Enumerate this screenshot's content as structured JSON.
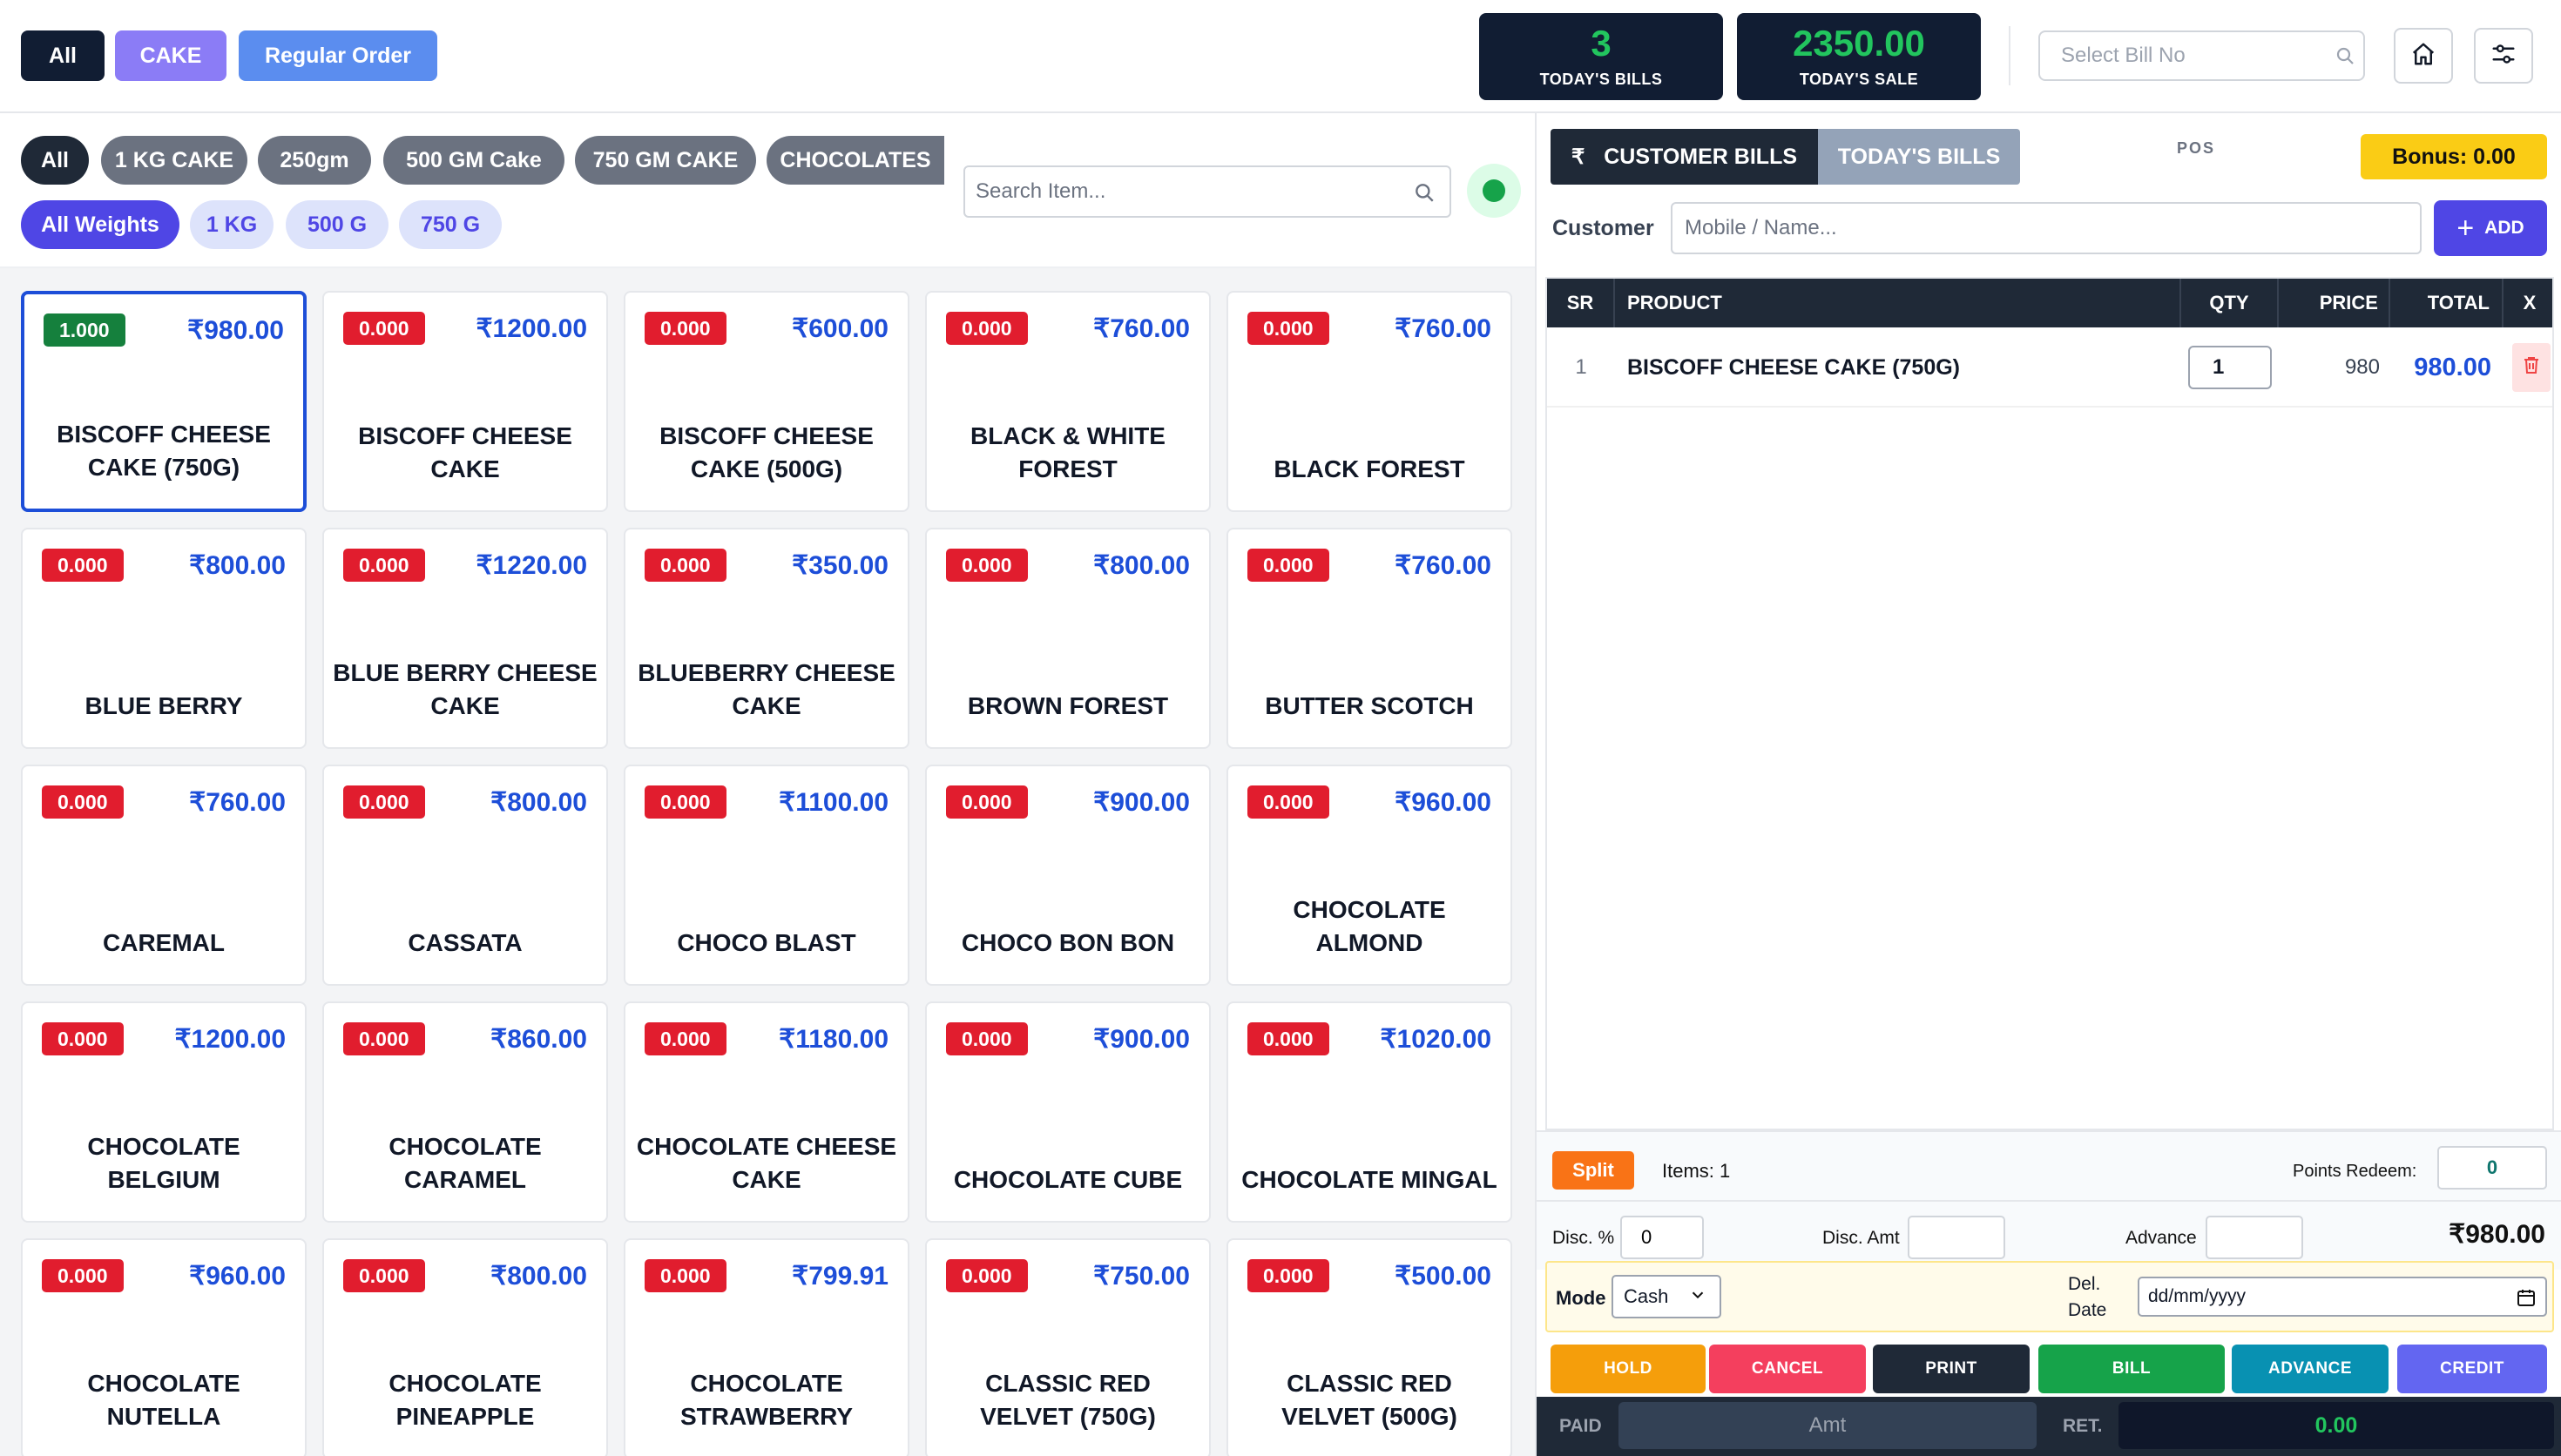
{
  "header": {
    "order_tabs": [
      "All",
      "CAKE",
      "Regular Order"
    ],
    "stats": [
      {
        "value": "3",
        "label": "TODAY'S BILLS"
      },
      {
        "value": "2350.00",
        "label": "TODAY'S SALE"
      }
    ],
    "bill_search": {
      "placeholder": "Select Bill No"
    },
    "icons": [
      "search-icon",
      "home-icon",
      "sliders-icon"
    ]
  },
  "filters": {
    "categories": [
      "All",
      "1 KG CAKE",
      "250gm",
      "500 GM Cake",
      "750 GM CAKE",
      "CHOCOLATES"
    ],
    "weights": [
      "All Weights",
      "1 KG",
      "500 G",
      "750 G"
    ],
    "search_placeholder": "Search Item...",
    "colors": {
      "online": "#16a34a",
      "accent": "#4f46e5"
    }
  },
  "products": [
    {
      "name": "BISCOFF CHEESE CAKE (750G)",
      "qty": "1.000",
      "price": "₹980.00",
      "selected": true
    },
    {
      "name": "BISCOFF CHEESE CAKE",
      "qty": "0.000",
      "price": "₹1200.00"
    },
    {
      "name": "BISCOFF CHEESE CAKE (500G)",
      "qty": "0.000",
      "price": "₹600.00"
    },
    {
      "name": "BLACK & WHITE FOREST",
      "qty": "0.000",
      "price": "₹760.00"
    },
    {
      "name": "BLACK FOREST",
      "qty": "0.000",
      "price": "₹760.00"
    },
    {
      "name": "BLUE BERRY",
      "qty": "0.000",
      "price": "₹800.00"
    },
    {
      "name": "BLUE BERRY CHEESE CAKE",
      "qty": "0.000",
      "price": "₹1220.00"
    },
    {
      "name": "BLUEBERRY CHEESE CAKE",
      "qty": "0.000",
      "price": "₹350.00"
    },
    {
      "name": "BROWN FOREST",
      "qty": "0.000",
      "price": "₹800.00"
    },
    {
      "name": "BUTTER SCOTCH",
      "qty": "0.000",
      "price": "₹760.00"
    },
    {
      "name": "CAREMAL",
      "qty": "0.000",
      "price": "₹760.00"
    },
    {
      "name": "CASSATA",
      "qty": "0.000",
      "price": "₹800.00"
    },
    {
      "name": "CHOCO BLAST",
      "qty": "0.000",
      "price": "₹1100.00"
    },
    {
      "name": "CHOCO BON BON",
      "qty": "0.000",
      "price": "₹900.00"
    },
    {
      "name": "CHOCOLATE ALMOND",
      "qty": "0.000",
      "price": "₹960.00"
    },
    {
      "name": "CHOCOLATE BELGIUM",
      "qty": "0.000",
      "price": "₹1200.00"
    },
    {
      "name": "CHOCOLATE CARAMEL",
      "qty": "0.000",
      "price": "₹860.00"
    },
    {
      "name": "CHOCOLATE CHEESE CAKE",
      "qty": "0.000",
      "price": "₹1180.00"
    },
    {
      "name": "CHOCOLATE CUBE",
      "qty": "0.000",
      "price": "₹900.00"
    },
    {
      "name": "CHOCOLATE MINGAL",
      "qty": "0.000",
      "price": "₹1020.00"
    },
    {
      "name": "CHOCOLATE NUTELLA",
      "qty": "0.000",
      "price": "₹960.00"
    },
    {
      "name": "CHOCOLATE PINEAPPLE",
      "qty": "0.000",
      "price": "₹800.00"
    },
    {
      "name": "CHOCOLATE STRAWBERRY",
      "qty": "0.000",
      "price": "₹799.91"
    },
    {
      "name": "CLASSIC RED VELVET (750G)",
      "qty": "0.000",
      "price": "₹750.00"
    },
    {
      "name": "CLASSIC RED VELVET (500G)",
      "qty": "0.000",
      "price": "₹500.00"
    }
  ],
  "bill": {
    "tabs": {
      "customer_bills": "CUSTOMER BILLS",
      "rupee": "₹",
      "todays_bills": "TODAY'S BILLS"
    },
    "pos_label": "POS",
    "bonus": "Bonus: 0.00",
    "customer_label": "Customer",
    "customer_placeholder": "Mobile / Name...",
    "add_label": "ADD",
    "columns": [
      "SR",
      "PRODUCT",
      "QTY",
      "PRICE",
      "TOTAL",
      "X"
    ],
    "rows": [
      {
        "sr": "1",
        "product": "BISCOFF CHEESE CAKE (750G)",
        "qty": "1",
        "price": "980",
        "total": "980.00"
      }
    ],
    "split_label": "Split",
    "items_count": "Items: 1",
    "points_label": "Points Redeem:",
    "points_value": "0",
    "disc_pct_label": "Disc. %",
    "disc_pct_value": "0",
    "disc_amt_label": "Disc. Amt",
    "advance_label": "Advance",
    "grand_total": "₹980.00",
    "mode_label": "Mode",
    "mode_value": "Cash",
    "del_date_label": "Del. Date",
    "del_date_placeholder": "dd/mm/yyyy",
    "actions": [
      {
        "label": "HOLD",
        "color": "#f59e0b"
      },
      {
        "label": "CANCEL",
        "color": "#f43f5e"
      },
      {
        "label": "PRINT",
        "color": "#1f2937"
      },
      {
        "label": "BILL",
        "color": "#16a34a"
      },
      {
        "label": "ADVANCE",
        "color": "#0891b2"
      },
      {
        "label": "CREDIT",
        "color": "#6366f1"
      }
    ],
    "paid_label": "PAID",
    "paid_placeholder": "Amt",
    "ret_label": "RET.",
    "ret_value": "0.00"
  }
}
